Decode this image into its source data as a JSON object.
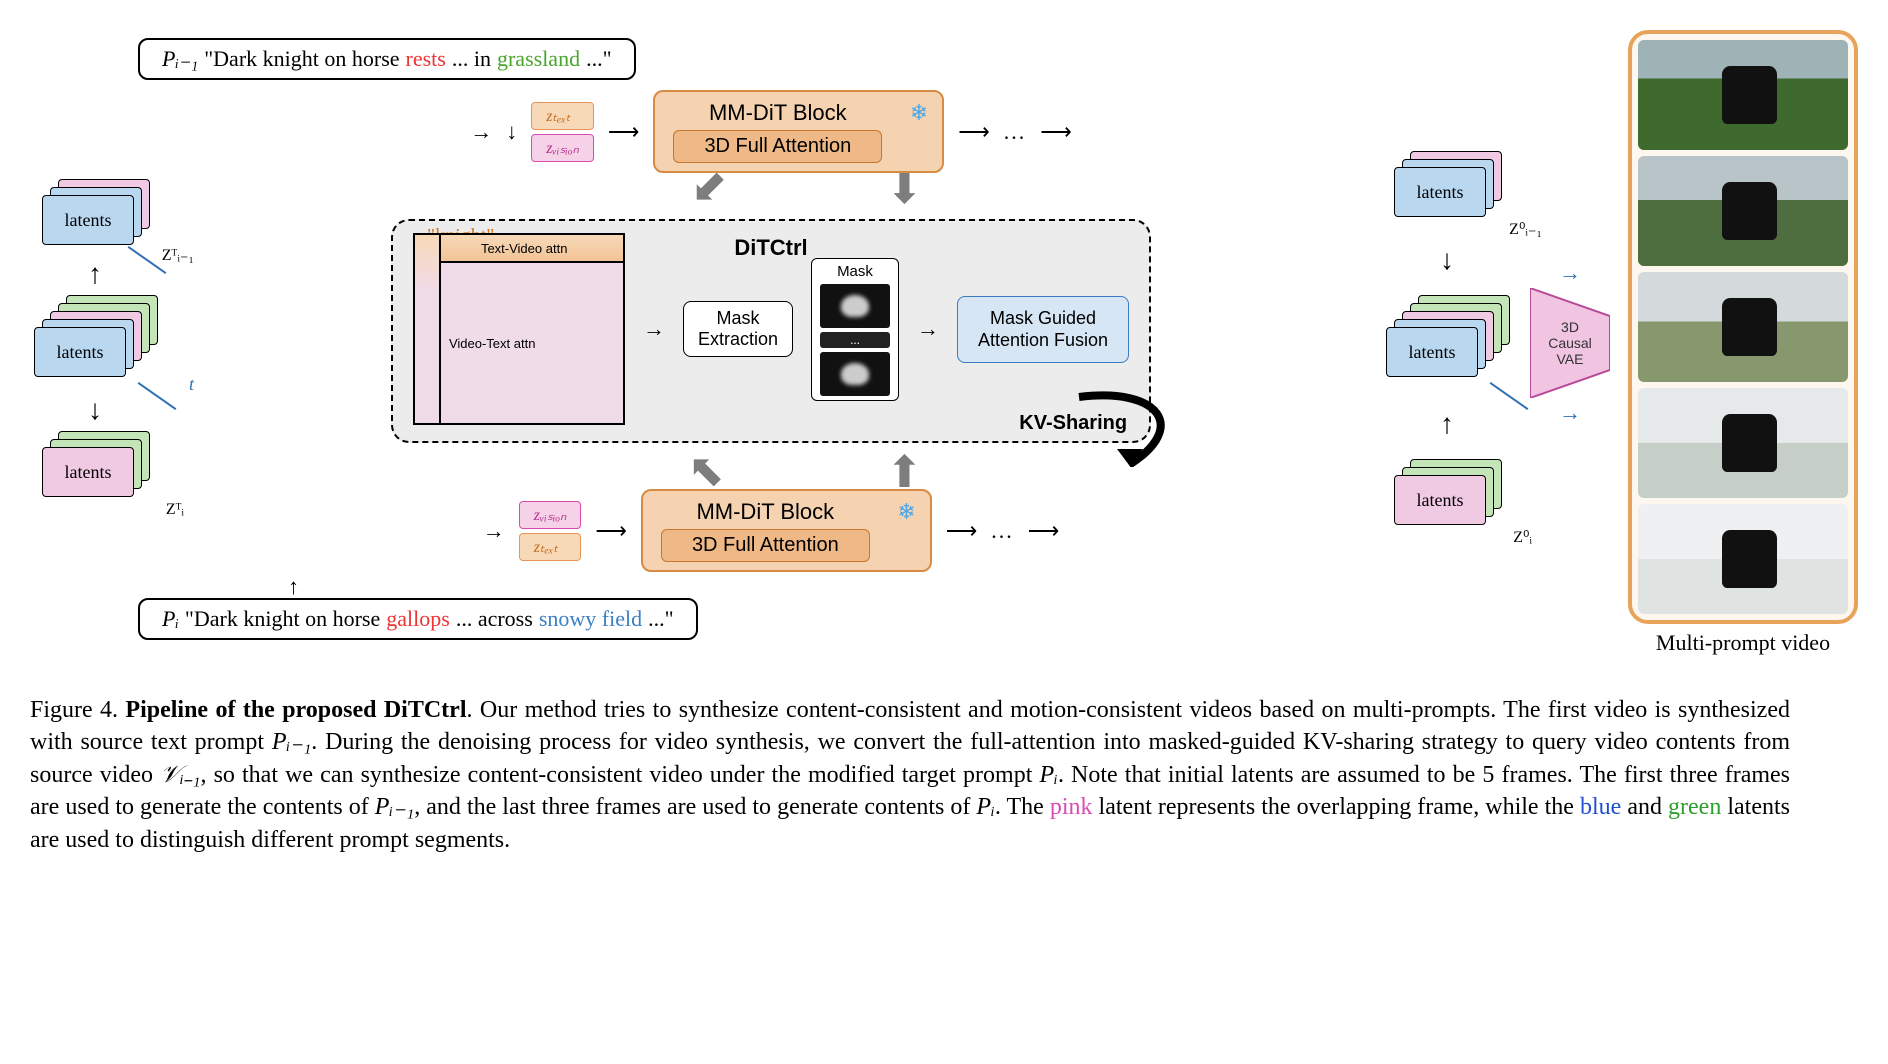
{
  "domain": "Diagram",
  "prompts": {
    "top": {
      "tag": "Pᵢ₋₁",
      "pre": "\"Dark knight on horse ",
      "w1": "rests",
      "mid": " ... in ",
      "w2": "grassland",
      "post": " ...\""
    },
    "bot": {
      "tag": "Pᵢ",
      "pre": "\"Dark knight on horse ",
      "w1": "gallops",
      "mid": " ... across ",
      "w2": "snowy field",
      "post": " ...\""
    }
  },
  "latent_labels": {
    "text": "zₜₑₓₜ",
    "vision": "zᵥᵢₛᵢₒₙ"
  },
  "z_labels": {
    "lt": "Zᵀᵢ₋₁",
    "lb": "Zᵀᵢ",
    "rt": "Z⁰ᵢ₋₁",
    "rb": "Z⁰ᵢ"
  },
  "mmdit": {
    "title": "MM-DiT Block",
    "inner": "3D Full Attention"
  },
  "ditctrl": {
    "title": "DiTCtrl",
    "token": "\"knight\"",
    "attn": {
      "tv": "Text-Video attn",
      "vt": "Video-Text attn"
    },
    "mask_ex": "Mask\nExtraction",
    "mask_lbl": "Mask",
    "fusion": "Mask Guided\nAttention Fusion",
    "kvshare": "KV-Sharing"
  },
  "latents_word": "latents",
  "t_axis": "t",
  "dots": "...",
  "vae": "3D\nCausal\nVAE",
  "strip_caption": "Multi-prompt video",
  "caption": {
    "lead": "Figure 4. ",
    "bold": "Pipeline of the proposed DiTCtrl",
    "body1": ". Our method tries to synthesize content-consistent and motion-consistent videos based on multi-prompts. The first video is synthesized with source text prompt ",
    "p_im1": "Pᵢ₋₁",
    "body2": ". During the denoising process for video synthesis, we convert the full-attention into masked-guided KV-sharing strategy to query video contents from source video ",
    "v_im1": "𝒱ᵢ₋₁",
    "body3": ", so that we can synthesize content-consistent video under the modified target prompt ",
    "p_i": "Pᵢ",
    "body4": ". Note that initial latents are assumed to be 5 frames. The first three frames are used to generate the contents of ",
    "p_im1b": "Pᵢ₋₁",
    "body5": ", and the last three frames are used to generate contents of ",
    "p_ib": "Pᵢ",
    "body6": ". The ",
    "pink": "pink",
    "body7": " latent represents the overlapping frame, while the ",
    "blue": "blue",
    "body8": " and ",
    "green": "green",
    "body9": " latents are used to distinguish different prompt segments."
  }
}
